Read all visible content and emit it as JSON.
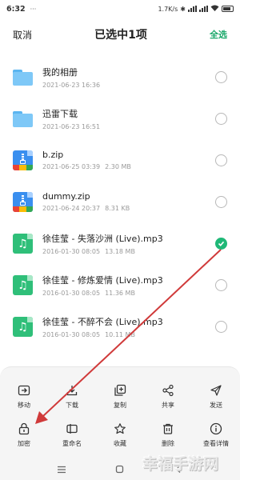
{
  "status_bar": {
    "time": "6:32",
    "speed": "1.7K/s",
    "battery_color": "#333333"
  },
  "header": {
    "cancel_label": "取消",
    "title": "已选中1项",
    "select_all_label": "全选",
    "accent_color": "#1aa86a"
  },
  "files": [
    {
      "icon": "folder-icon",
      "name": "我的相册",
      "date": "2021-06-23 16:36",
      "size": "",
      "checked": false
    },
    {
      "icon": "folder-icon",
      "name": "迅雷下载",
      "date": "2021-06-23 16:51",
      "size": "",
      "checked": false
    },
    {
      "icon": "zip-icon",
      "name": "b.zip",
      "date": "2021-06-25 03:39",
      "size": "2.30 MB",
      "checked": false
    },
    {
      "icon": "zip-icon",
      "name": "dummy.zip",
      "date": "2021-06-24 20:37",
      "size": "8.31 KB",
      "checked": false
    },
    {
      "icon": "music-icon",
      "name": "徐佳莹 - 失落沙洲 (Live).mp3",
      "date": "2016-01-30 08:05",
      "size": "13.18 MB",
      "checked": true
    },
    {
      "icon": "music-icon",
      "name": "徐佳莹 - 修炼爱情 (Live).mp3",
      "date": "2016-01-30 08:05",
      "size": "11.36 MB",
      "checked": false
    },
    {
      "icon": "music-icon",
      "name": "徐佳莹 - 不醉不会 (Live).mp3",
      "date": "2016-01-30 08:05",
      "size": "10.11 MB",
      "checked": false
    }
  ],
  "actions": {
    "row1": [
      {
        "icon": "move-icon",
        "label": "移动"
      },
      {
        "icon": "download-icon",
        "label": "下载"
      },
      {
        "icon": "copy-icon",
        "label": "复制"
      },
      {
        "icon": "share-icon",
        "label": "共享"
      },
      {
        "icon": "send-icon",
        "label": "发送"
      }
    ],
    "row2": [
      {
        "icon": "lock-icon",
        "label": "加密"
      },
      {
        "icon": "rename-icon",
        "label": "重命名"
      },
      {
        "icon": "star-icon",
        "label": "收藏"
      },
      {
        "icon": "trash-icon",
        "label": "删除"
      },
      {
        "icon": "info-icon",
        "label": "查看详情"
      }
    ]
  },
  "annotation_color": "#d03a3a",
  "watermark": "幸福手游网"
}
